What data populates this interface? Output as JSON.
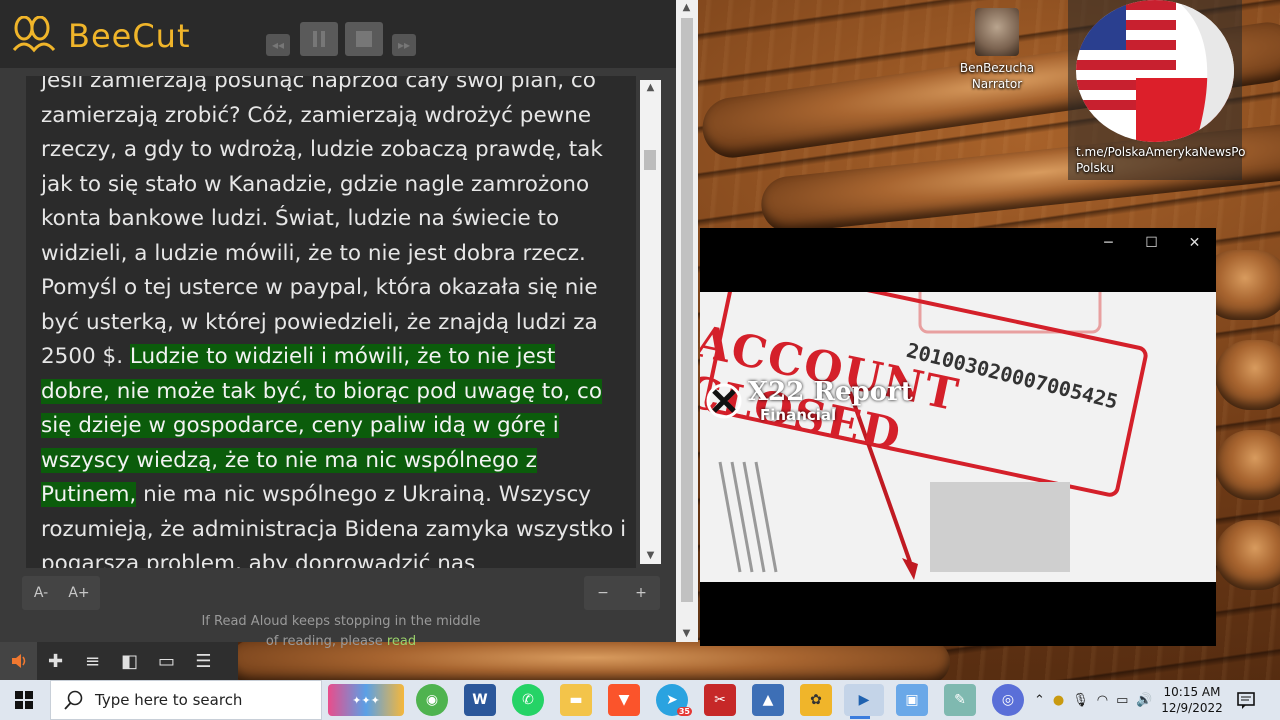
{
  "beecut": {
    "brand": "BeeCut",
    "controls": [
      "rewind",
      "pause",
      "stop",
      "forward"
    ]
  },
  "reader": {
    "text_before": "jeśli zamierzają posunąć naprzód cały swój plan, co zamierzają zrobić? Cóż, zamierzają wdrożyć pewne rzeczy, a gdy to wdrożą, ludzie zobaczą prawdę, tak jak to się stało w Kanadzie, gdzie nagle zamrożono konta bankowe ludzi. Świat, ludzie na świecie to widzieli, a ludzie mówili, że to nie jest dobra rzecz. Pomyśl o tej usterce w paypal, która okazała się nie być usterką, w której powiedzieli, że znajdą ludzi za 2500 $. ",
    "text_highlight": "Ludzie to widzieli i mówili, że to nie jest dobre, nie może tak być, to biorąc pod uwagę to, co się dzieje w gospodarce, ceny paliw idą w górę i wszyscy wiedzą, że to nie ma nic wspólnego z Putinem,",
    "text_after": " nie ma nic wspólnego z Ukrainą. Wszyscy rozumieją, że administracja Bidena zamyka wszystko i pogarsza problem, aby doprowadzić nas",
    "font_decrease": "A-",
    "font_increase": "A+",
    "speed_decrease": "−",
    "speed_increase": "+",
    "notice_text": "If Read Aloud keeps stopping in the middle of reading, please ",
    "notice_link": "read"
  },
  "desktop": {
    "narrator_label": "BenBezucha Narrator",
    "channel_label": "t.me/PolskaAmerykaNewsPo Polsku"
  },
  "video": {
    "logo_text": "X22 Report",
    "logo_sub": "Financial",
    "stamp_text": "ACCOUNT CLOSED",
    "number_text": "201003020007005425"
  },
  "taskbar": {
    "search_placeholder": "Type here to search",
    "time": "10:15 AM",
    "date": "12/9/2022",
    "badge": "35"
  },
  "colors": {
    "highlight": "#0b5c0b",
    "brand": "#f0b52a",
    "stamp_red": "#d4202a"
  }
}
